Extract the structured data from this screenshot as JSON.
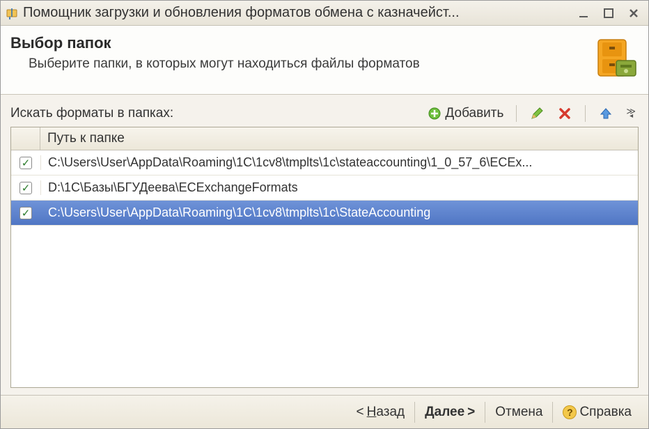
{
  "window": {
    "title": "Помощник загрузки и обновления форматов обмена с казначейст..."
  },
  "header": {
    "title": "Выбор папок",
    "subtitle": "Выберите папки, в которых могут находиться файлы форматов"
  },
  "toolbar": {
    "search_label": "Искать форматы в папках:",
    "add_label": "Добавить"
  },
  "grid": {
    "column_header": "Путь к папке",
    "rows": [
      {
        "checked": true,
        "selected": false,
        "path": "C:\\Users\\User\\AppData\\Roaming\\1C\\1cv8\\tmplts\\1c\\stateaccounting\\1_0_57_6\\ECEx..."
      },
      {
        "checked": true,
        "selected": false,
        "path": "D:\\1С\\Базы\\БГУДеева\\ECExchangeFormats"
      },
      {
        "checked": true,
        "selected": true,
        "path": "C:\\Users\\User\\AppData\\Roaming\\1C\\1cv8\\tmplts\\1c\\StateAccounting"
      }
    ]
  },
  "footer": {
    "back": "Назад",
    "next": "Далее",
    "cancel": "Отмена",
    "help": "Справка"
  }
}
